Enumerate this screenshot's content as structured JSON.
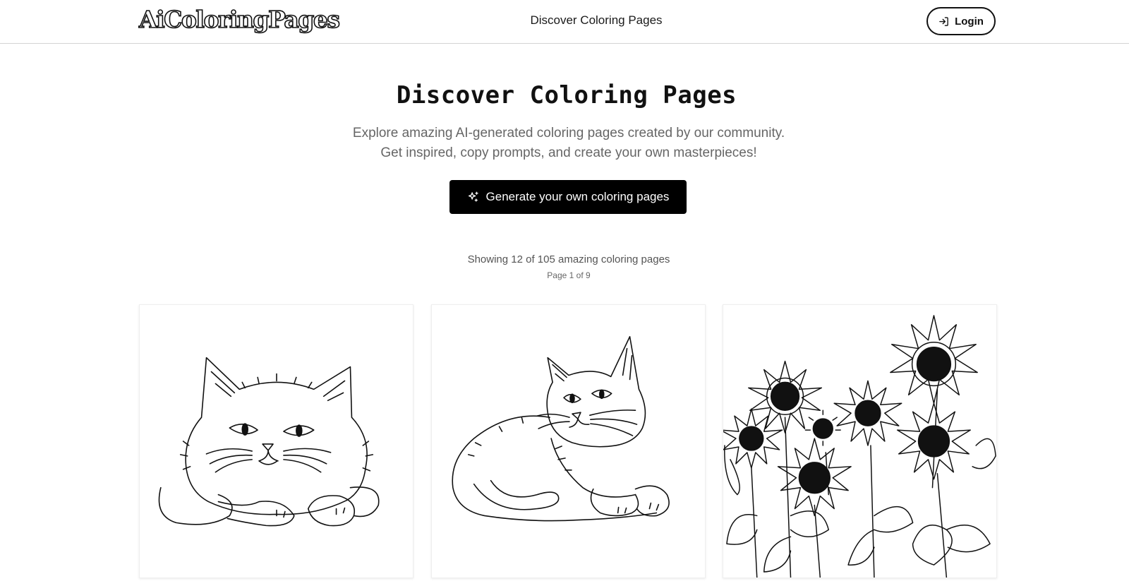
{
  "header": {
    "logo_text": "AiColoringPages",
    "nav_link": "Discover Coloring Pages",
    "login_label": "Login",
    "login_icon": "login-icon"
  },
  "hero": {
    "title": "Discover Coloring Pages",
    "subtitle_line1": "Explore amazing AI-generated coloring pages created by our community.",
    "subtitle_line2": "Get inspired, copy prompts, and create your own masterpieces!",
    "cta_label": "Generate your own coloring pages",
    "cta_icon": "sparkles-icon"
  },
  "results": {
    "showing_text": "Showing 12 of 105 amazing coloring pages",
    "page_text": "Page 1 of 9"
  },
  "gallery": [
    {
      "image": "fluffy-cat-coloring-page"
    },
    {
      "image": "lying-cat-coloring-page"
    },
    {
      "image": "sunflowers-coloring-page"
    }
  ],
  "colors": {
    "primary_button": "#000000",
    "text_muted": "#666666",
    "divider": "#d4d4d4"
  }
}
